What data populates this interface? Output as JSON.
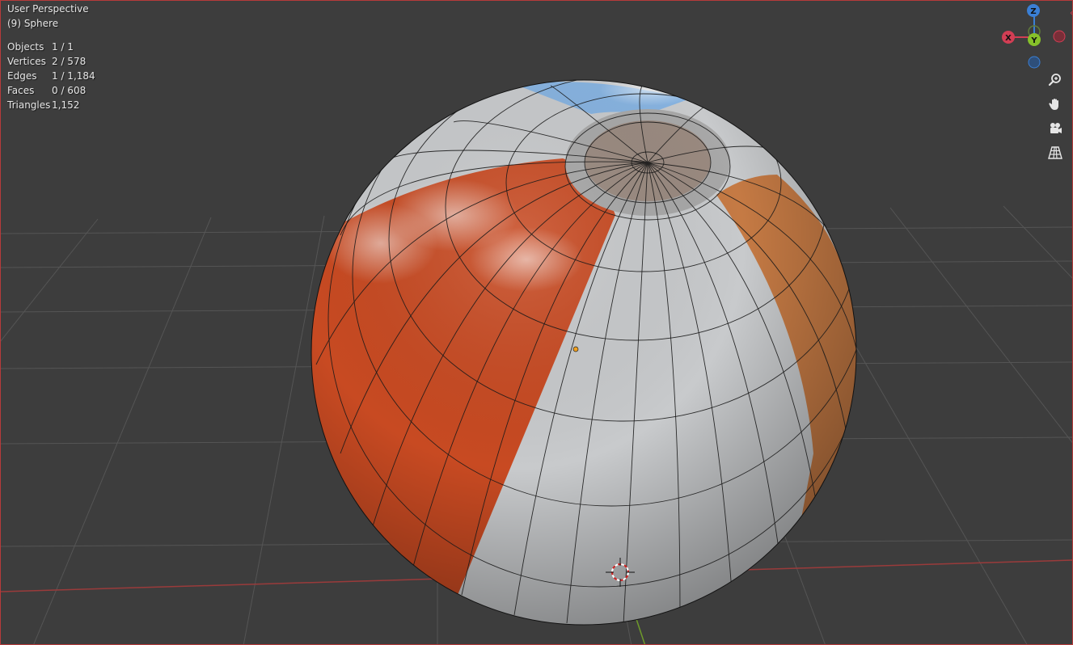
{
  "viewport": {
    "view_title": "User Perspective",
    "active_object": "(9) Sphere",
    "stats": [
      {
        "label": "Objects",
        "value": "1 / 1"
      },
      {
        "label": "Vertices",
        "value": "2 / 578"
      },
      {
        "label": "Edges",
        "value": "1 / 1,184"
      },
      {
        "label": "Faces",
        "value": "0 / 608"
      },
      {
        "label": "Triangles",
        "value": "1,152"
      }
    ]
  },
  "gizmo": {
    "x_label": "X",
    "y_label": "Y",
    "z_label": "Z",
    "x_color": "#d23e54",
    "y_color": "#86c12a",
    "z_color": "#3a7fd5"
  },
  "tools": [
    {
      "name": "zoom-icon"
    },
    {
      "name": "hand-pan-icon"
    },
    {
      "name": "camera-icon"
    },
    {
      "name": "perspective-grid-icon"
    }
  ],
  "colors": {
    "background": "#3d3d3d",
    "grid_line": "#555555",
    "x_axis": "#9a3b3b",
    "ball_white": "#c8cacc",
    "ball_red": "#c84a22",
    "ball_orange": "#c57a44",
    "ball_blue": "#87b3e0",
    "viewport_border": "#b73a3a"
  }
}
